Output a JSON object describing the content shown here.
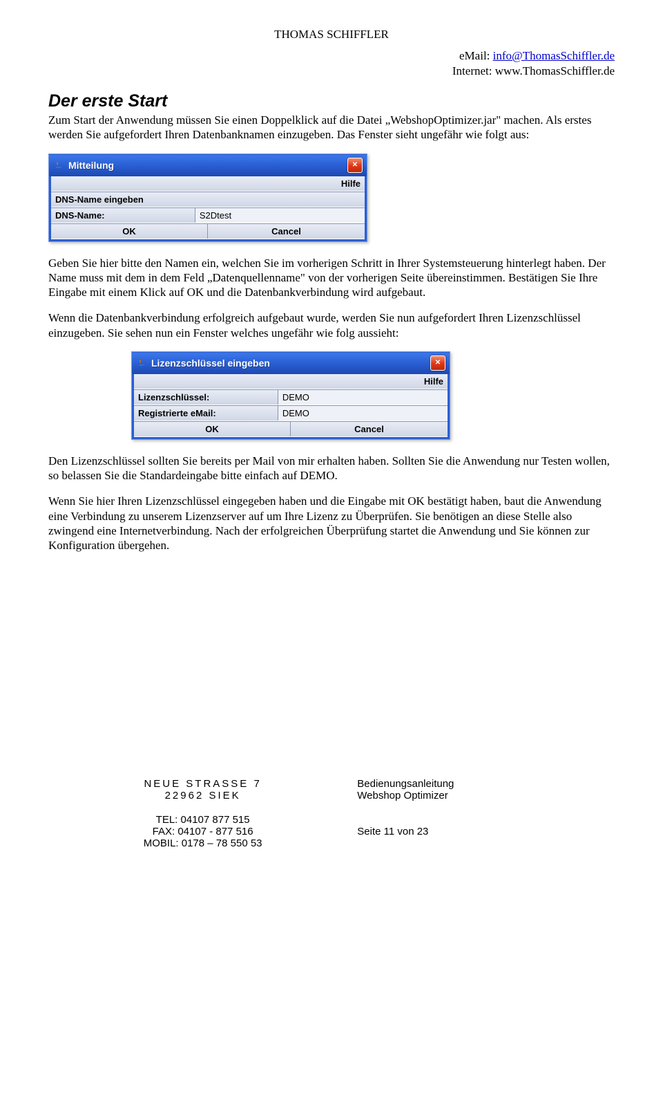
{
  "header": {
    "name": "THOMAS SCHIFFLER",
    "email_label": "eMail: ",
    "email_link": "info@ThomasSchiffler.de",
    "internet_label": "Internet: www.ThomasSchiffler.de"
  },
  "section_title": "Der erste Start",
  "para1": "Zum Start der Anwendung müssen Sie einen Doppelklick auf die Datei „WebshopOptimizer.jar\" machen. Als erstes werden Sie aufgefordert Ihren Datenbanknamen einzugeben. Das Fenster sieht ungefähr wie folgt aus:",
  "dialog1": {
    "title": "Mitteilung",
    "help": "Hilfe",
    "heading": "DNS-Name eingeben",
    "label": "DNS-Name:",
    "value": "S2Dtest",
    "ok": "OK",
    "cancel": "Cancel"
  },
  "para2": "Geben Sie hier bitte den Namen ein, welchen Sie im vorherigen Schritt in Ihrer Systemsteuerung hinterlegt haben. Der Name muss mit dem in dem Feld „Datenquellenname\" von der vorherigen Seite übereinstimmen. Bestätigen Sie Ihre Eingabe mit einem Klick auf OK und die Datenbankverbindung wird aufgebaut.",
  "para3": "Wenn die Datenbankverbindung erfolgreich aufgebaut wurde, werden Sie nun aufgefordert Ihren Lizenzschlüssel einzugeben. Sie sehen nun ein Fenster welches ungefähr wie folg aussieht:",
  "dialog2": {
    "title": "Lizenzschlüssel eingeben",
    "help": "Hilfe",
    "label1": "Lizenzschlüssel:",
    "value1": "DEMO",
    "label2": "Registrierte eMail:",
    "value2": "DEMO",
    "ok": "OK",
    "cancel": "Cancel"
  },
  "para4": "Den Lizenzschlüssel sollten Sie bereits per Mail von mir erhalten haben. Sollten Sie die Anwendung nur Testen wollen, so belassen Sie die Standardeingabe bitte einfach auf DEMO.",
  "para5": "Wenn Sie hier Ihren Lizenzschlüssel eingegeben haben und die Eingabe mit OK bestätigt haben, baut die Anwendung eine Verbindung zu unserem Lizenzserver auf um Ihre Lizenz zu Überprüfen. Sie benötigen an diese Stelle also zwingend eine Internetverbindung. Nach der erfolgreichen Überprüfung startet die Anwendung und Sie können zur Konfiguration übergehen.",
  "footer": {
    "addr1": "NEUE STRASSE 7",
    "addr2": "22962 SIEK",
    "doc1": "Bedienungsanleitung",
    "doc2": "Webshop Optimizer",
    "tel": "TEL: 04107 877 515",
    "fax": "FAX: 04107 - 877 516",
    "mobil": "MOBIL: 0178 – 78 550 53",
    "page": "Seite 11 von 23"
  }
}
